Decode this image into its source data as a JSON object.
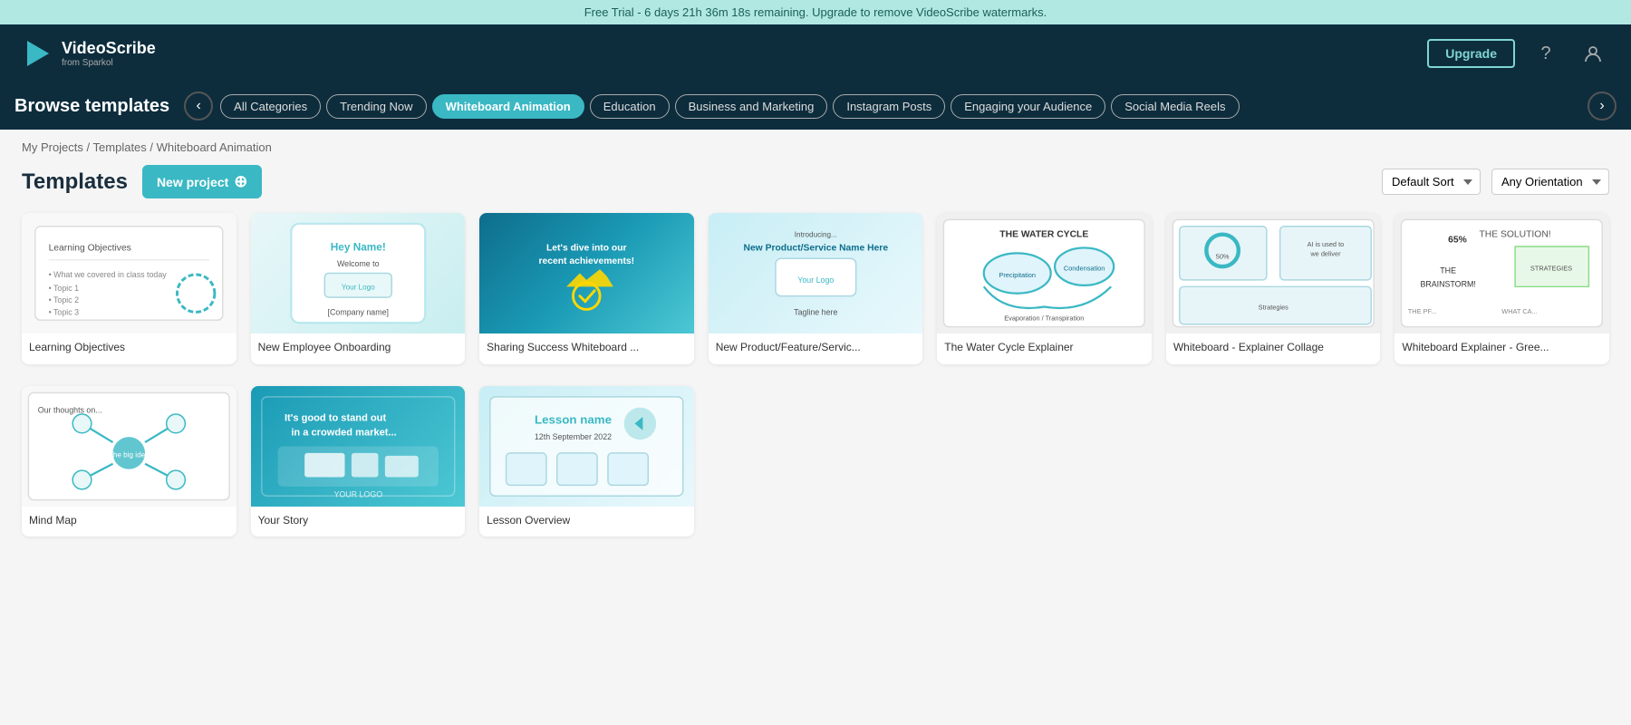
{
  "banner": {
    "text": "Free Trial - 6 days 21h 36m 18s remaining. Upgrade to remove VideoScribe watermarks."
  },
  "navbar": {
    "logo_text": "VideoScribe",
    "logo_sub": "from Sparkol",
    "upgrade_label": "Upgrade"
  },
  "categories_bar": {
    "browse_title": "Browse templates",
    "categories": [
      {
        "id": "all",
        "label": "All Categories",
        "active": false
      },
      {
        "id": "trending",
        "label": "Trending Now",
        "active": false
      },
      {
        "id": "whiteboard",
        "label": "Whiteboard Animation",
        "active": true
      },
      {
        "id": "education",
        "label": "Education",
        "active": false
      },
      {
        "id": "business",
        "label": "Business and Marketing",
        "active": false
      },
      {
        "id": "instagram",
        "label": "Instagram Posts",
        "active": false
      },
      {
        "id": "engaging",
        "label": "Engaging your Audience",
        "active": false
      },
      {
        "id": "social",
        "label": "Social Media Reels",
        "active": false
      }
    ]
  },
  "breadcrumb": {
    "my_projects": "My Projects",
    "templates": "Templates",
    "current": "Whiteboard Animation"
  },
  "templates_section": {
    "title": "Templates",
    "new_project_label": "New project",
    "sort_label": "Default Sort",
    "orientation_label": "Any Orientation"
  },
  "templates": [
    {
      "id": 1,
      "name": "Learning Objectives",
      "thumb_type": "learning"
    },
    {
      "id": 2,
      "name": "New Employee Onboarding",
      "thumb_type": "employee"
    },
    {
      "id": 3,
      "name": "Sharing Success Whiteboard ...",
      "thumb_type": "success"
    },
    {
      "id": 4,
      "name": "New Product/Feature/Servic...",
      "thumb_type": "product"
    },
    {
      "id": 5,
      "name": "The Water Cycle Explainer",
      "thumb_type": "water"
    },
    {
      "id": 6,
      "name": "Whiteboard - Explainer Collage",
      "thumb_type": "explainer"
    },
    {
      "id": 7,
      "name": "Whiteboard Explainer - Gree...",
      "thumb_type": "green"
    },
    {
      "id": 8,
      "name": "Mind Map",
      "thumb_type": "mindmap"
    },
    {
      "id": 9,
      "name": "Your Story",
      "thumb_type": "story"
    },
    {
      "id": 10,
      "name": "Lesson Overview",
      "thumb_type": "lesson"
    }
  ]
}
